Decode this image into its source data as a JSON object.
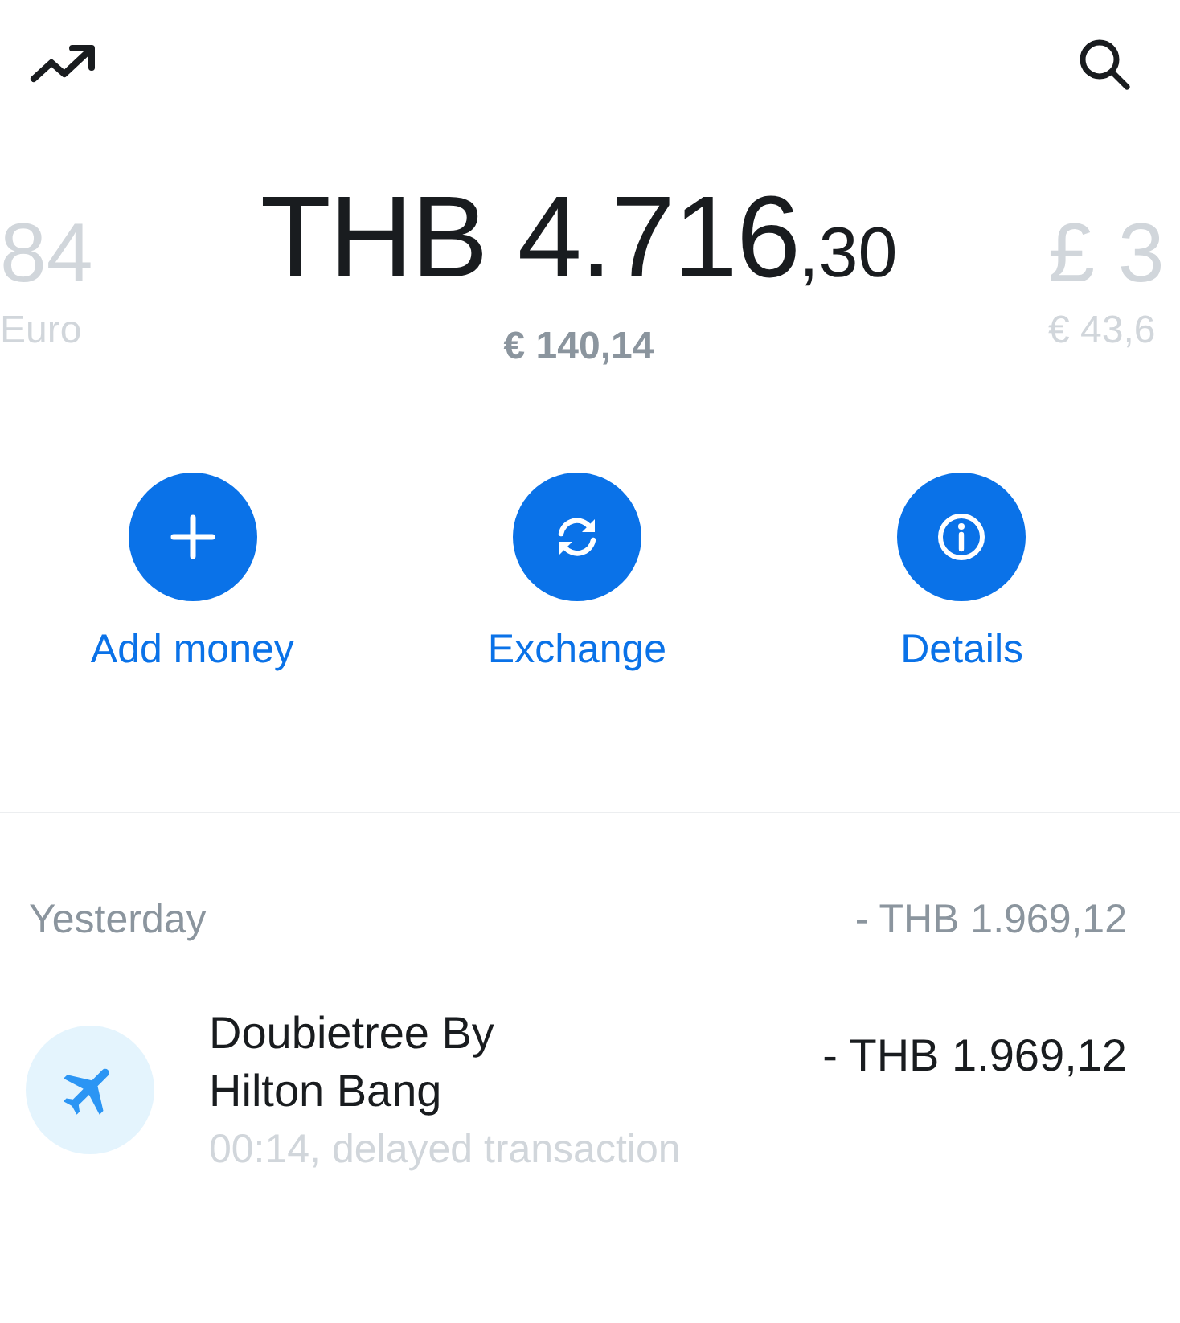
{
  "balances": [
    {
      "amount": "84",
      "converted": "Euro",
      "selected": false
    },
    {
      "amount": "THB 4.716",
      "decimals": ",30",
      "converted": "€ 140,14",
      "selected": true
    },
    {
      "amount": "£ 3",
      "converted": "€ 43,6",
      "selected": false
    }
  ],
  "actions": [
    {
      "kind": "plus",
      "label": "Add money"
    },
    {
      "kind": "exchange",
      "label": "Exchange"
    },
    {
      "kind": "info",
      "label": "Details"
    }
  ],
  "day": {
    "label": "Yesterday",
    "total": "- THB 1.969,12"
  },
  "transactions": [
    {
      "title": "Doubietree By Hilton Bang",
      "amount": "- THB 1.969,12",
      "subtitle": "00:14, delayed transaction"
    }
  ]
}
